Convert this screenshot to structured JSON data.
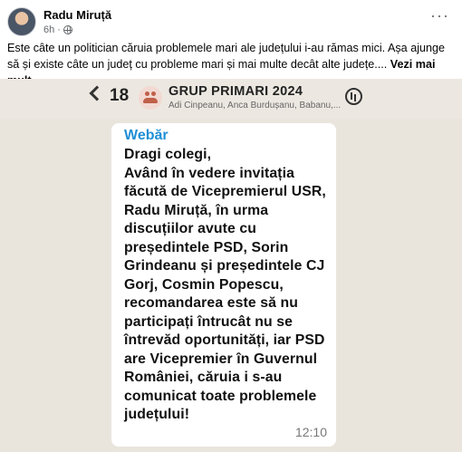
{
  "post": {
    "author": "Radu Miruță",
    "time": "6h",
    "dot": "·",
    "more": "···",
    "text": "Este câte un politician căruia problemele mari ale județului i-au rămas mici. Așa ajunge să și existe câte un județ cu probleme mari și mai multe decât alte județe....",
    "see_more": "Vezi mai mult"
  },
  "chat": {
    "back_count": "18",
    "group_name": "GRUP PRIMARI 2024",
    "members": "Adi Cinpeanu, Anca Burdușanu, Babanu,...",
    "sender": "Webăr",
    "message": "Dragi colegi,\nAvând în vedere invitația făcută de Vicepremierul USR, Radu Miruță, în urma discuțiilor avute cu președintele PSD, Sorin Grindeanu și președintele CJ Gorj, Cosmin Popescu, recomandarea este să nu participați întrucât nu se întrevăd oportunități, iar PSD are Vicepremier în Guvernul României, căruia i s-au comunicat toate problemele județului!",
    "time": "12:10"
  },
  "icons": [
    "avatar",
    "globe-icon",
    "more-options-icon",
    "back-chevron-icon",
    "group-icon",
    "call-icon"
  ]
}
